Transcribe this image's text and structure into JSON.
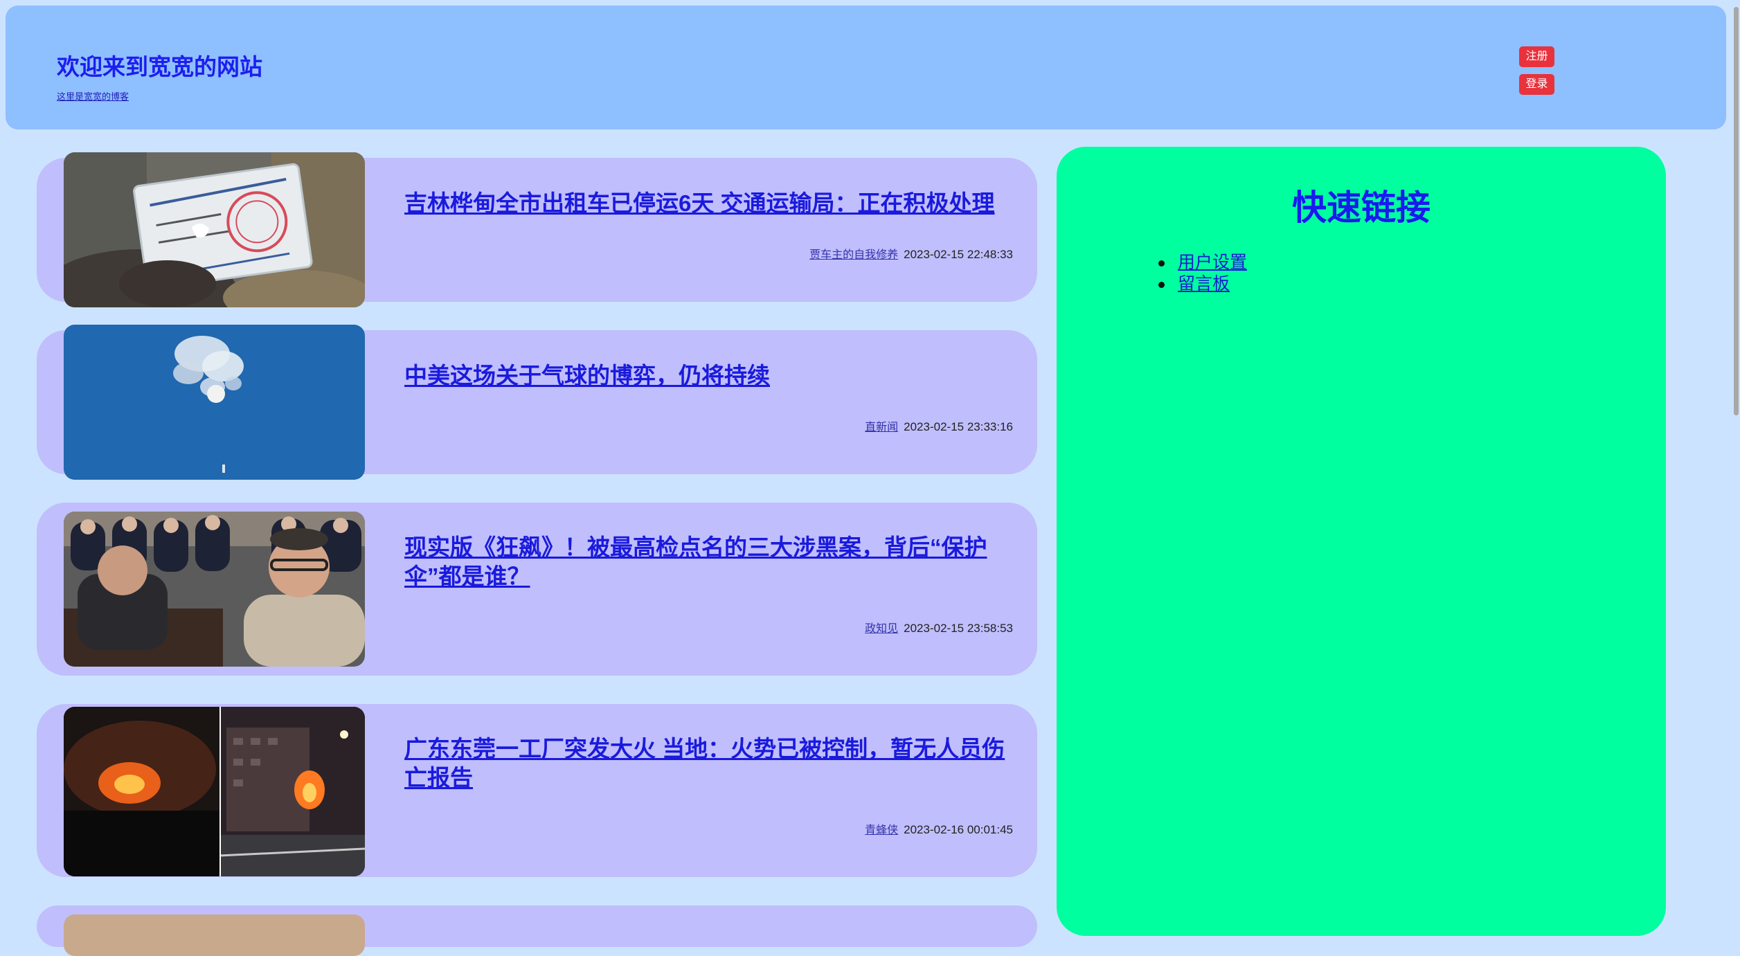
{
  "header": {
    "title": "欢迎来到宽宽的网站",
    "subtitle": "这里是宽宽的博客",
    "register_label": "注册",
    "login_label": "登录"
  },
  "articles": [
    {
      "title": "吉林桦甸全市出租车已停运6天 交通运输局：正在积极处理",
      "author": "贾车主的自我修养",
      "time": "2023-02-15 22:48:33"
    },
    {
      "title": "中美这场关于气球的博弈，仍将持续",
      "author": "直新闻",
      "time": "2023-02-15 23:33:16"
    },
    {
      "title": "现实版《狂飙》！被最高检点名的三大涉黑案，背后“保护伞”都是谁？",
      "author": "政知见",
      "time": "2023-02-15 23:58:53"
    },
    {
      "title": "广东东莞一工厂突发大火 当地：火势已被控制，暂无人员伤亡报告",
      "author": "青蜂侠",
      "time": "2023-02-16 00:01:45"
    }
  ],
  "sidebar": {
    "title": "快速链接",
    "links": [
      "用户设置",
      "留言板"
    ]
  },
  "colors": {
    "page_bg": "#cce3ff",
    "header_bg": "#8ebfff",
    "card_bg": "#c0befc",
    "sidebar_bg": "#00ff9f",
    "button_bg": "#e8323c",
    "link": "#1a1add"
  }
}
